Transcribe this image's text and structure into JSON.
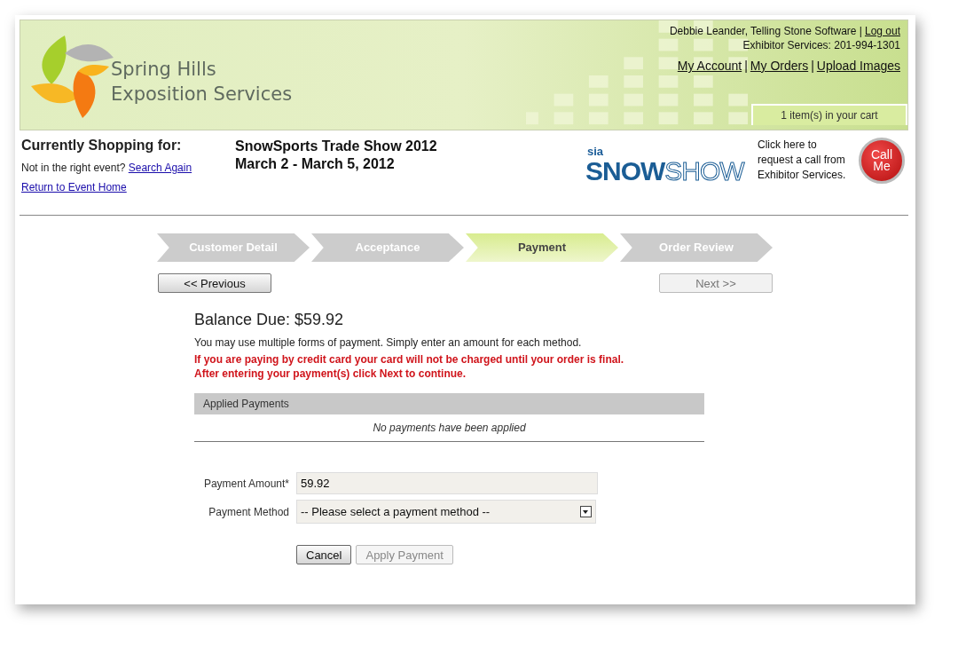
{
  "header": {
    "brand": [
      "Spring Hills",
      "Exposition Services"
    ],
    "user": "Debbie Leander, Telling Stone Software |",
    "logout": "Log out",
    "phone": "Exhibitor Services: 201-994-1301",
    "links": [
      {
        "label": "My Account"
      },
      {
        "label": "My Orders",
        "sep": "|"
      },
      {
        "label": "Upload Images",
        "sep": "|"
      }
    ],
    "cart": "1 item(s) in your cart"
  },
  "event": {
    "heading": "Currently Shopping for:",
    "prompt": "Not in the right event?",
    "search_link": "Search Again",
    "home_link": "Return to Event Home",
    "name": "SnowSports Trade Show 2012",
    "dates": "March 2 - March 5, 2012",
    "logo": {
      "small": "sia",
      "bold": "SNOW",
      "outline": "SHOW"
    }
  },
  "call": {
    "text": "Click here to request a call from Exhibitor Services.",
    "button": "Call Me"
  },
  "steps": [
    {
      "label": "Customer Detail",
      "selected": false
    },
    {
      "label": "Acceptance",
      "selected": false
    },
    {
      "label": "Payment",
      "selected": true
    },
    {
      "label": "Order Review",
      "selected": false
    }
  ],
  "nav": [
    {
      "label": "<< Previous",
      "disabled": false
    },
    {
      "label": "Next >>",
      "disabled": true
    }
  ],
  "payment": {
    "balance": "Balance Due: $59.92",
    "note": "You may use multiple forms of payment. Simply enter an amount for each method.",
    "warnings": [
      "If you are paying by credit card your card will not be charged until your order is final.",
      "After entering your payment(s) click Next to continue."
    ],
    "applied_header": "Applied Payments",
    "applied_empty": "No payments have been applied",
    "amount_label": "Payment Amount*",
    "amount_value": "59.92",
    "method_label": "Payment Method",
    "method_value": "-- Please select a payment method --",
    "buttons": [
      {
        "label": "Cancel",
        "disabled": false
      },
      {
        "label": "Apply Payment",
        "disabled": true
      }
    ]
  }
}
